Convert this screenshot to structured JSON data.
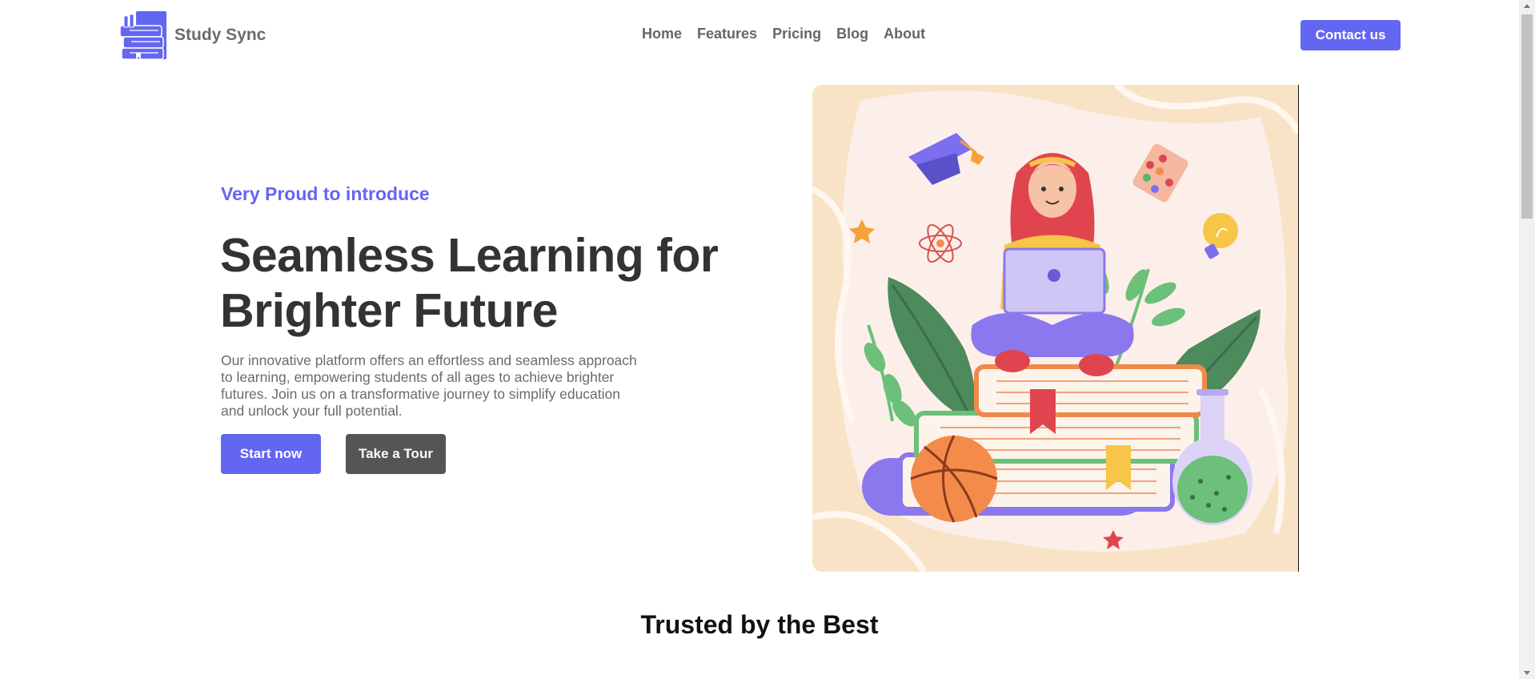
{
  "brand": {
    "name": "Study Sync",
    "logo_icon": "books-icon",
    "accent": "#6366f1"
  },
  "nav": {
    "items": [
      {
        "label": "Home"
      },
      {
        "label": "Features"
      },
      {
        "label": "Pricing"
      },
      {
        "label": "Blog"
      },
      {
        "label": "About"
      }
    ],
    "contact_label": "Contact us"
  },
  "hero": {
    "eyebrow": "Very Proud to introduce",
    "headline_line1": "Seamless Learning for",
    "headline_line2": "Brighter Future",
    "description": "Our innovative platform offers an effortless and seamless approach to learning, empowering students of all ages to achieve brighter futures. Join us on a transformative journey to simplify education and unlock your full potential.",
    "primary_button": "Start now",
    "secondary_button": "Take a Tour",
    "illustration": "student-studying-on-books-illustration"
  },
  "trusted": {
    "title": "Trusted by the Best"
  }
}
